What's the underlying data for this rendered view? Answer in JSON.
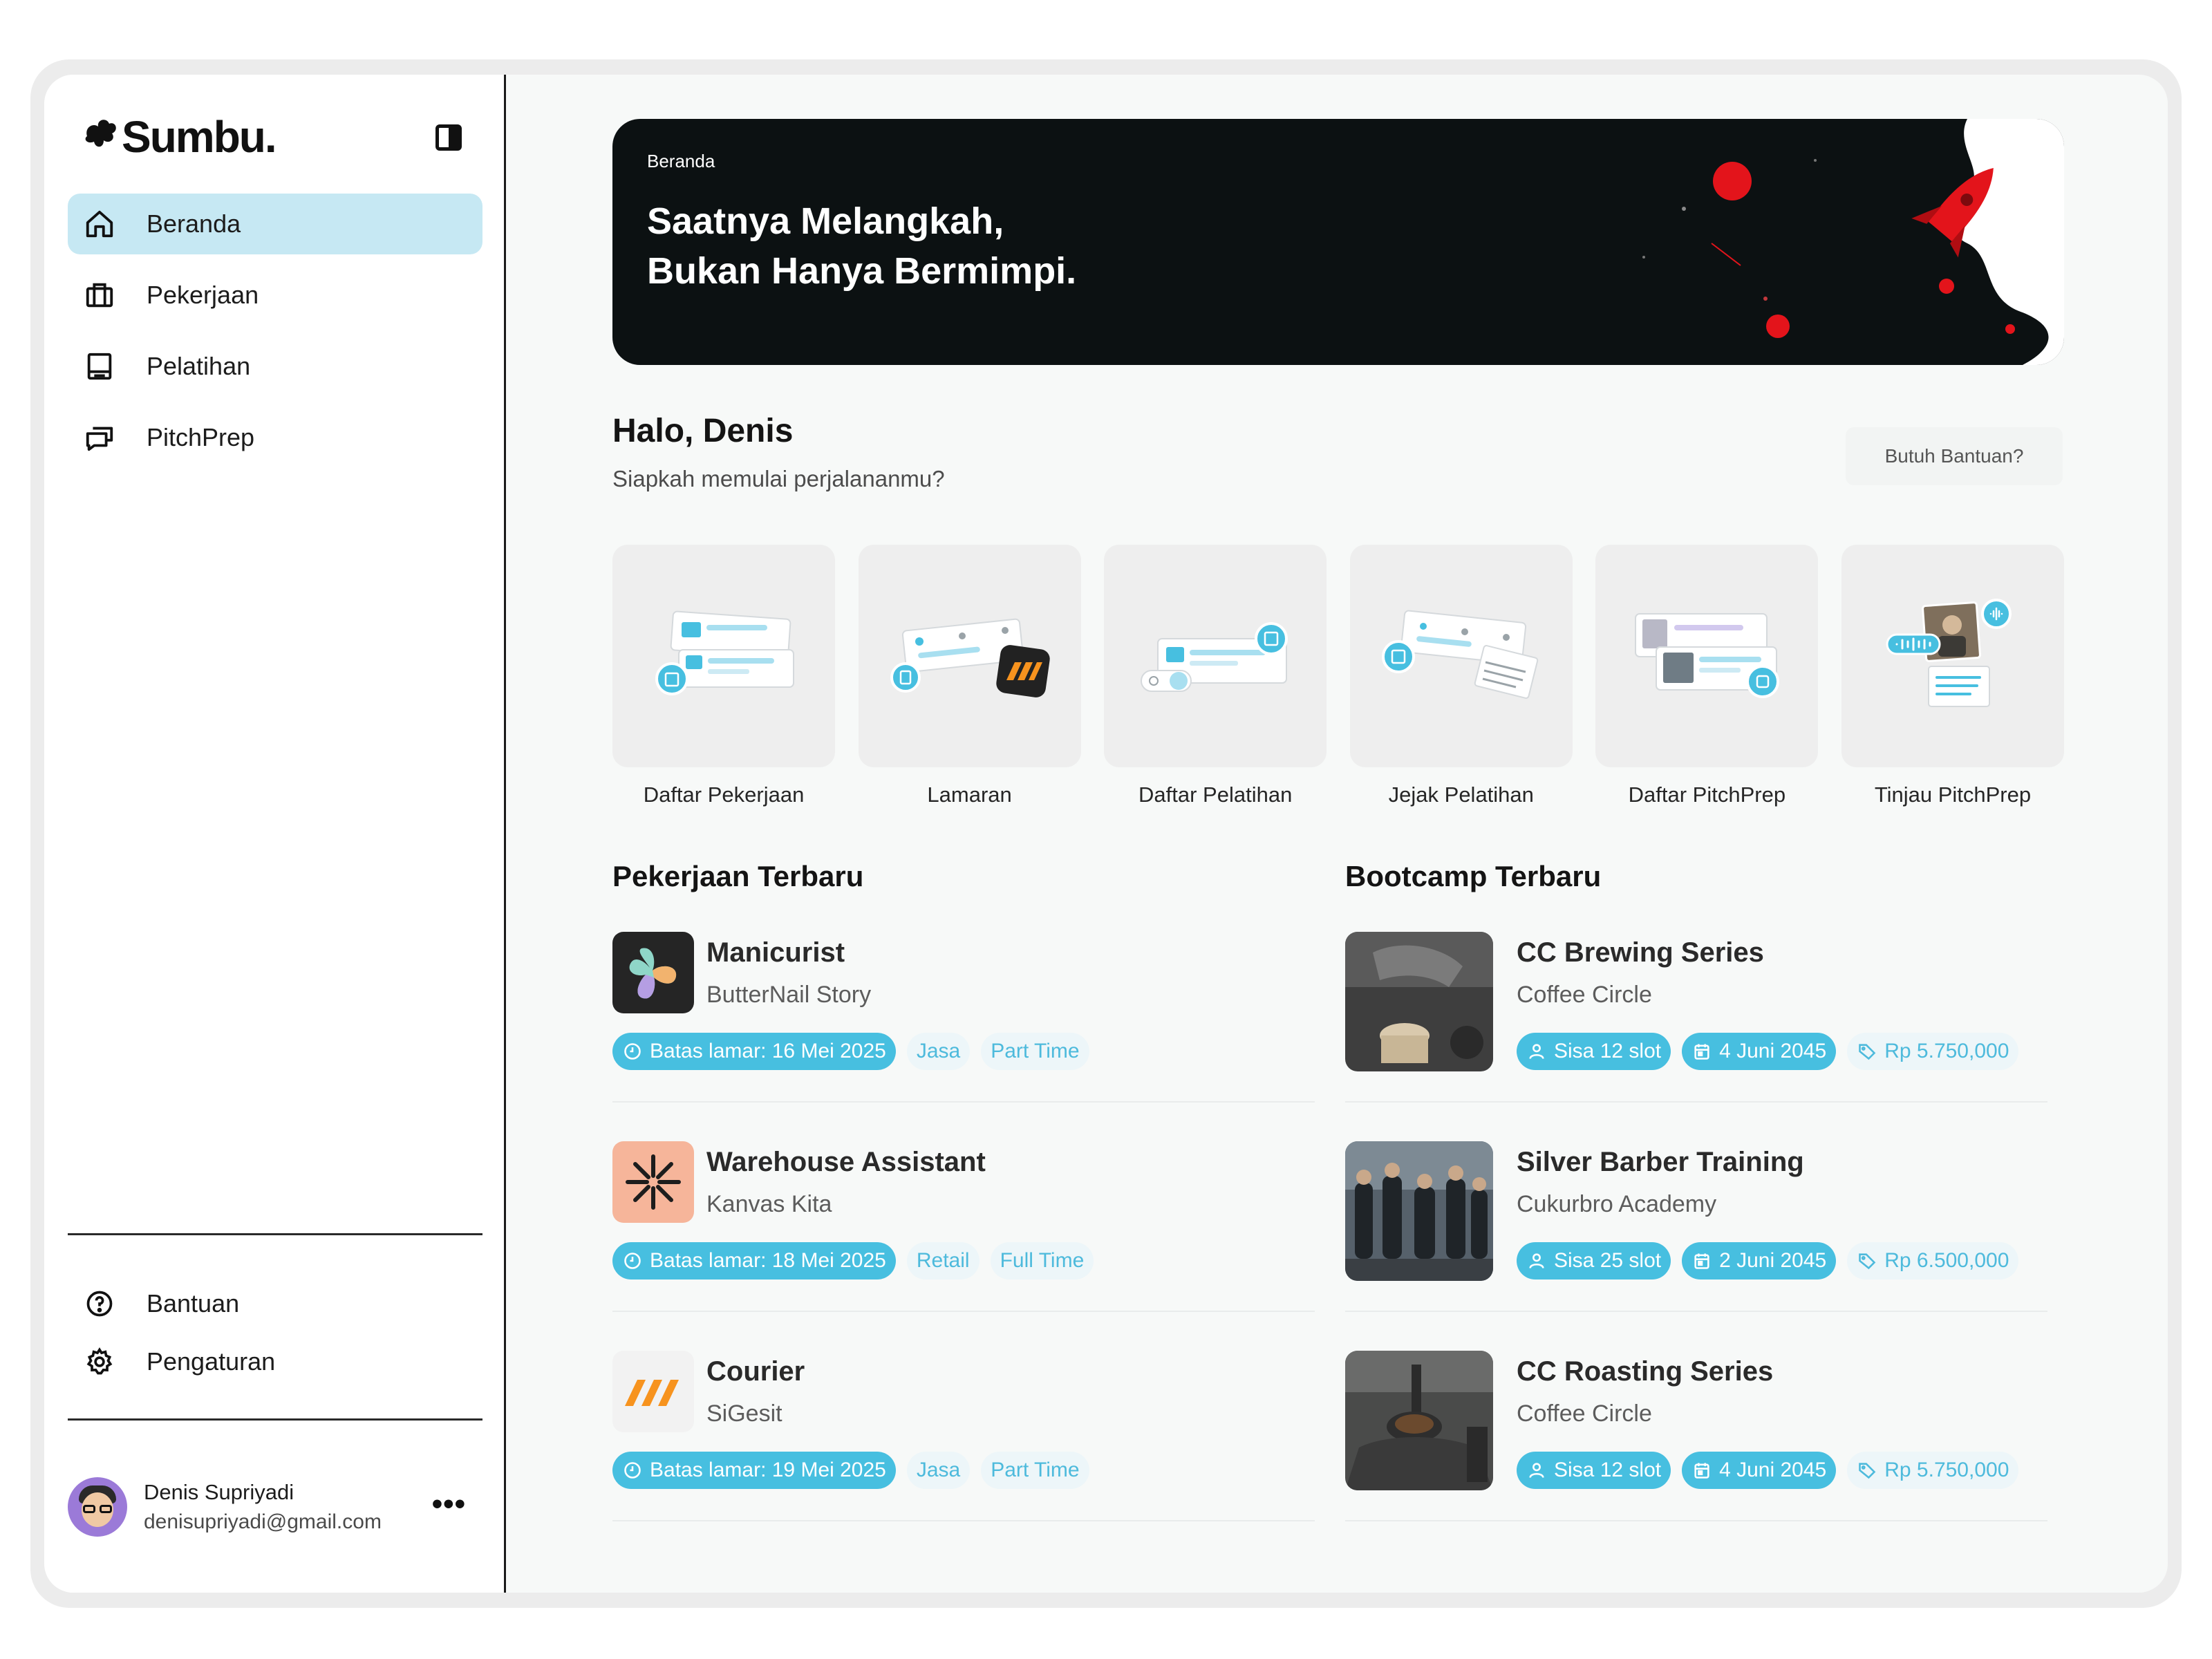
{
  "app": {
    "name": "Sumbu."
  },
  "sidebar": {
    "items": [
      {
        "label": "Beranda",
        "icon": "home-icon",
        "active": true
      },
      {
        "label": "Pekerjaan",
        "icon": "briefcase-icon",
        "active": false
      },
      {
        "label": "Pelatihan",
        "icon": "book-icon",
        "active": false
      },
      {
        "label": "PitchPrep",
        "icon": "chat-bubbles-icon",
        "active": false
      }
    ],
    "bottom_items": [
      {
        "label": "Bantuan",
        "icon": "help-circle-icon"
      },
      {
        "label": "Pengaturan",
        "icon": "gear-icon"
      }
    ],
    "profile": {
      "name": "Denis Supriyadi",
      "email": "denisupriyadi@gmail.com"
    }
  },
  "hero": {
    "breadcrumb": "Beranda",
    "title_line1": "Saatnya Melangkah,",
    "title_line2": "Bukan Hanya Bermimpi."
  },
  "greeting": {
    "title": "Halo, Denis",
    "subtitle": "Siapkah memulai perjalananmu?",
    "help_button": "Butuh Bantuan?"
  },
  "shortcuts": [
    {
      "label": "Daftar Pekerjaan"
    },
    {
      "label": "Lamaran"
    },
    {
      "label": "Daftar Pelatihan"
    },
    {
      "label": "Jejak Pelatihan"
    },
    {
      "label": "Daftar PitchPrep"
    },
    {
      "label": "Tinjau PitchPrep"
    }
  ],
  "jobs": {
    "title": "Pekerjaan Terbaru",
    "items": [
      {
        "title": "Manicurist",
        "company": "ButterNail Story",
        "deadline": "Batas lamar: 16 Mei 2025",
        "category": "Jasa",
        "type": "Part Time"
      },
      {
        "title": "Warehouse Assistant",
        "company": "Kanvas Kita",
        "deadline": "Batas lamar: 18 Mei 2025",
        "category": "Retail",
        "type": "Full Time"
      },
      {
        "title": "Courier",
        "company": "SiGesit",
        "deadline": "Batas lamar: 19 Mei 2025",
        "category": "Jasa",
        "type": "Part Time"
      }
    ]
  },
  "bootcamps": {
    "title": "Bootcamp Terbaru",
    "items": [
      {
        "title": "CC Brewing Series",
        "org": "Coffee Circle",
        "slots": "Sisa 12 slot",
        "date": "4 Juni 2045",
        "price": "Rp 5.750,000"
      },
      {
        "title": "Silver Barber Training",
        "org": "Cukurbro Academy",
        "slots": "Sisa 25 slot",
        "date": "2 Juni 2045",
        "price": "Rp 6.500,000"
      },
      {
        "title": "CC Roasting Series",
        "org": "Coffee Circle",
        "slots": "Sisa 12 slot",
        "date": "4 Juni 2045",
        "price": "Rp 5.750,000"
      }
    ]
  },
  "colors": {
    "accent": "#47bfe0",
    "active_nav": "#c6e8f3",
    "hero_bg": "#0c1112",
    "rocket": "#e3141b"
  }
}
